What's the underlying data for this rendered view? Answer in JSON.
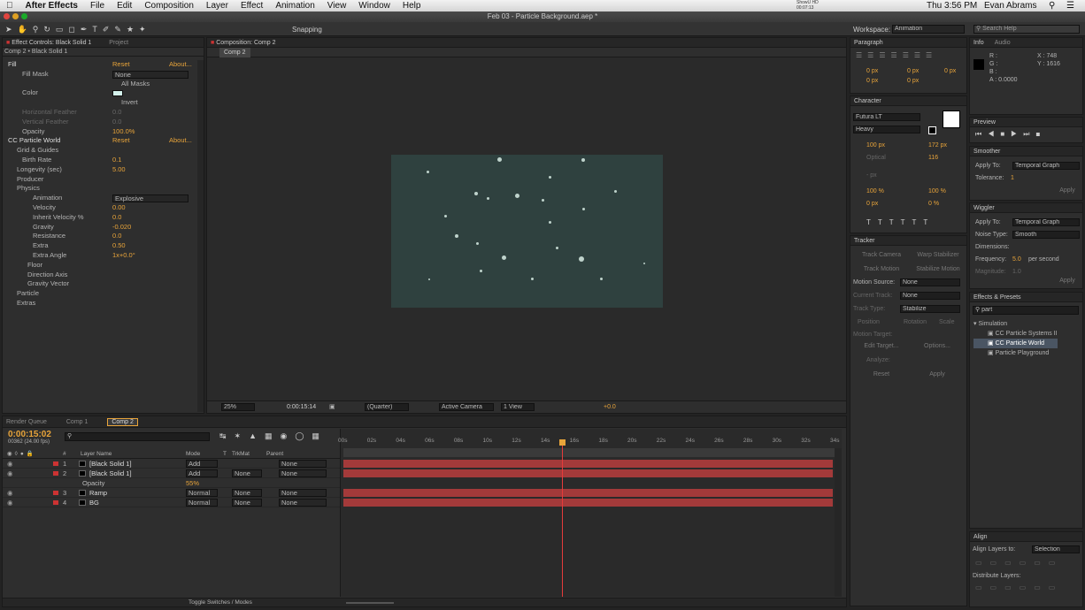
{
  "menubar": {
    "app": "After Effects",
    "items": [
      "File",
      "Edit",
      "Composition",
      "Layer",
      "Effect",
      "Animation",
      "View",
      "Window",
      "Help"
    ],
    "right": {
      "clock": "Thu 3:56 PM",
      "user": "Evan Abrams",
      "showu": "ShowU HD",
      "showu_time": "00:07:13"
    }
  },
  "window": {
    "title": "Feb 03 - Particle Background.aep *"
  },
  "toolbar": {
    "snapping": "Snapping",
    "workspace_label": "Workspace:",
    "workspace_value": "Animation",
    "search_placeholder": "Search Help"
  },
  "effect_controls": {
    "tab": "Effect Controls: Black Solid 1",
    "tab2": "Project",
    "subtitle": "Comp 2 • Black Solid 1",
    "rows": [
      {
        "label": "Fill",
        "value": "Reset",
        "value2": "About..."
      },
      {
        "label": "Fill Mask",
        "value": "None"
      },
      {
        "label": "",
        "value": "All Masks"
      },
      {
        "label": "Color",
        "value": ""
      },
      {
        "label": "",
        "value": "Invert"
      },
      {
        "label": "Horizontal Feather",
        "value": "0.0"
      },
      {
        "label": "Vertical Feather",
        "value": "0.0"
      },
      {
        "label": "Opacity",
        "value": "100.0%"
      },
      {
        "label": "CC Particle World",
        "value": "Reset",
        "value2": "About..."
      },
      {
        "label": "Grid & Guides",
        "value": ""
      },
      {
        "label": "Birth Rate",
        "value": "0.1"
      },
      {
        "label": "Longevity (sec)",
        "value": "5.00"
      },
      {
        "label": "Producer",
        "value": ""
      },
      {
        "label": "Physics",
        "value": ""
      },
      {
        "label": "Animation",
        "value": "Explosive"
      },
      {
        "label": "Velocity",
        "value": "0.00"
      },
      {
        "label": "Inherit Velocity %",
        "value": "0.0"
      },
      {
        "label": "Gravity",
        "value": "-0.020"
      },
      {
        "label": "Resistance",
        "value": "0.0"
      },
      {
        "label": "Extra",
        "value": "0.50"
      },
      {
        "label": "Extra Angle",
        "value": "1x+0.0°"
      },
      {
        "label": "Floor",
        "value": ""
      },
      {
        "label": "Direction Axis",
        "value": ""
      },
      {
        "label": "Gravity Vector",
        "value": ""
      },
      {
        "label": "Particle",
        "value": ""
      },
      {
        "label": "Extras",
        "value": ""
      }
    ]
  },
  "composition": {
    "tab": "Composition: Comp 2",
    "subtab": "Comp 2",
    "zoom": "25%",
    "timecode": "0:00:15:14",
    "resolution": "(Quarter)",
    "camera": "Active Camera",
    "views": "1 View",
    "exposure": "+0.0"
  },
  "paragraph": {
    "tab": "Paragraph",
    "v1": "0 px",
    "v2": "0 px",
    "v3": "0 px",
    "v4": "0 px",
    "v5": "0 px"
  },
  "character": {
    "tab": "Character",
    "font": "Futura LT",
    "style": "Heavy",
    "size": "100 px",
    "leading": "172 px",
    "kerning": "Optical",
    "tracking": "116",
    "stroke": "- px",
    "vscale": "100 %",
    "hscale": "100 %",
    "baseline": "0 px",
    "tsume": "0 %"
  },
  "tracker": {
    "tab": "Tracker",
    "track_camera": "Track Camera",
    "warp": "Warp Stabilizer",
    "track_motion": "Track Motion",
    "stabilize": "Stabilize Motion",
    "motion_source_label": "Motion Source:",
    "motion_source": "None",
    "current_track_label": "Current Track:",
    "current_track": "None",
    "track_type_label": "Track Type:",
    "track_type": "Stabilize",
    "position": "Position",
    "rotation": "Rotation",
    "scale": "Scale",
    "motion_target": "Motion Target:",
    "edit_target": "Edit Target...",
    "options": "Options...",
    "analyze": "Analyze:",
    "reset": "Reset",
    "apply": "Apply"
  },
  "info": {
    "tab": "Info",
    "tab2": "Audio",
    "r": "R :",
    "g": "G :",
    "b": "B :",
    "a": "A : 0.0000",
    "x": "X : 748",
    "y": "Y : 1616"
  },
  "preview": {
    "tab": "Preview"
  },
  "smoother": {
    "tab": "Smoother",
    "apply_to_label": "Apply To:",
    "apply_to": "Temporal Graph",
    "tolerance_label": "Tolerance:",
    "tolerance": "1",
    "apply": "Apply"
  },
  "wiggler": {
    "tab": "Wiggler",
    "apply_to_label": "Apply To:",
    "apply_to": "Temporal Graph",
    "noise_label": "Noise Type:",
    "noise": "Smooth",
    "dimensions": "Dimensions:",
    "frequency_label": "Frequency:",
    "frequency": "5.0",
    "frequency_unit": "per second",
    "magnitude_label": "Magnitude:",
    "magnitude": "1.0",
    "apply": "Apply"
  },
  "effects_presets": {
    "tab": "Effects & Presets",
    "search": "part",
    "category": "Simulation",
    "items": [
      "CC Particle Systems II",
      "CC Particle World",
      "Particle Playground"
    ]
  },
  "align": {
    "tab": "Align",
    "align_label": "Align Layers to:",
    "align_value": "Selection",
    "distribute": "Distribute Layers:"
  },
  "timeline": {
    "tabs": [
      "Render Queue",
      "Comp 1",
      "Comp 2"
    ],
    "timecode": "0:00:15:02",
    "frames": "00362 (24.00 fps)",
    "headers": {
      "name": "Layer Name",
      "mode": "Mode",
      "t": "T",
      "trkmat": "TrkMat",
      "parent": "Parent"
    },
    "ruler": [
      "00s",
      "02s",
      "04s",
      "06s",
      "08s",
      "10s",
      "12s",
      "14s",
      "16s",
      "18s",
      "20s",
      "22s",
      "24s",
      "26s",
      "28s",
      "30s",
      "32s",
      "34s"
    ],
    "playhead_fraction": 0.444,
    "layers": [
      {
        "num": "1",
        "name": "[Black Solid 1]",
        "mode": "Add",
        "trkmat": "",
        "parent": "None"
      },
      {
        "num": "2",
        "name": "[Black Solid 1]",
        "mode": "Add",
        "trkmat": "None",
        "parent": "None"
      },
      {
        "num": "",
        "name": "Opacity",
        "mode": "55%",
        "trkmat": "",
        "parent": ""
      },
      {
        "num": "3",
        "name": "Ramp",
        "mode": "Normal",
        "trkmat": "None",
        "parent": "None"
      },
      {
        "num": "4",
        "name": "BG",
        "mode": "Normal",
        "trkmat": "None",
        "parent": "None"
      }
    ],
    "toggle": "Toggle Switches / Modes"
  }
}
